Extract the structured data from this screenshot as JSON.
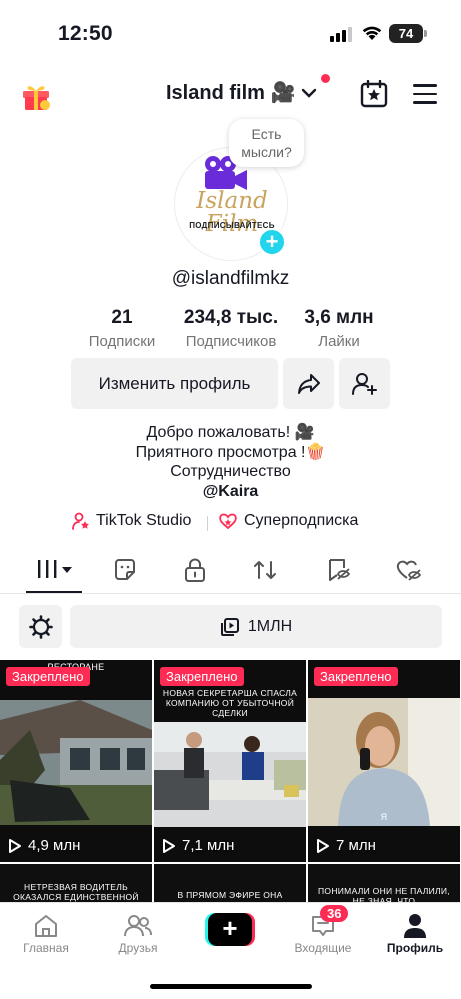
{
  "status_bar": {
    "time": "12:50",
    "battery": "74"
  },
  "header": {
    "account_name": "Island film 🎥"
  },
  "avatar": {
    "thought_bubble": "Есть мысли?",
    "logo_text": "Island Film",
    "logo_subtext": "ПОДПИСЫВАЙТЕСЬ"
  },
  "profile": {
    "handle": "@islandfilmkz"
  },
  "stats": [
    {
      "value": "21",
      "label": "Подписки"
    },
    {
      "value": "234,8 тыс.",
      "label": "Подписчиков"
    },
    {
      "value": "3,6 млн",
      "label": "Лайки"
    }
  ],
  "buttons": {
    "edit_profile": "Изменить профиль"
  },
  "bio": {
    "line1": "Добро пожаловать! 🎥",
    "line2": "Приятного просмотра !🍿",
    "line3": "Сотрудничество",
    "line4": "@Kaira"
  },
  "links": {
    "studio": "TikTok Studio",
    "subscription": "Суперподписка"
  },
  "filter": {
    "views_label": "1МЛН"
  },
  "videos": [
    {
      "pinned": "Закреплено",
      "views": "4,9 млн",
      "caption": "РЕСТОРАНЕ"
    },
    {
      "pinned": "Закреплено",
      "views": "7,1 млн",
      "caption": "НОВАЯ СЕКРЕТАРША СПАСЛА КОМПАНИЮ ОТ УБЫТОЧНОЙ СДЕЛКИ"
    },
    {
      "pinned": "Закреплено",
      "views": "7 млн",
      "caption": "Я"
    },
    {
      "caption": "НЕТРЕЗВАЯ ВОДИТЕЛЬ ОКАЗАЛСЯ ЕДИНСТВЕННОЙ ДОЧЕРЬЮ БОГАТОГО"
    },
    {
      "caption": "В ПРЯМОМ ЭФИРЕ ОНА УЗНАЕТ, ЧТО У ЕЕ"
    },
    {
      "caption": "ПОНИМАЛИ ОНИ НЕ ПАЛИЛИ, НЕ ЗНАЯ, ЧТО"
    }
  ],
  "bottom_nav": {
    "home": "Главная",
    "friends": "Друзья",
    "inbox": "Входящие",
    "inbox_badge": "36",
    "profile": "Профиль"
  },
  "colors": {
    "accent": "#fe2c55",
    "cyan": "#20d5ec"
  }
}
